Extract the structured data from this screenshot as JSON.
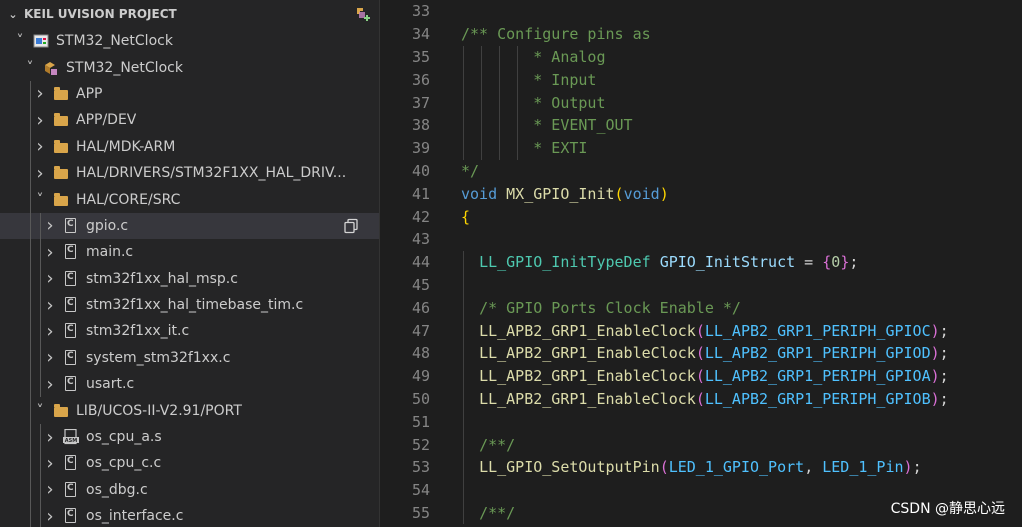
{
  "explorer": {
    "section_title": "KEIL UVISION PROJECT",
    "items": [
      {
        "label": "STM32_NetClock",
        "depth": 1,
        "expanded": true,
        "icon": "project-icon"
      },
      {
        "label": "STM32_NetClock",
        "depth": 2,
        "expanded": true,
        "icon": "target-icon"
      },
      {
        "label": "APP",
        "depth": 3,
        "expanded": false,
        "icon": "folder-icon"
      },
      {
        "label": "APP/DEV",
        "depth": 3,
        "expanded": false,
        "icon": "folder-icon"
      },
      {
        "label": "HAL/MDK-ARM",
        "depth": 3,
        "expanded": false,
        "icon": "folder-icon"
      },
      {
        "label": "HAL/DRIVERS/STM32F1XX_HAL_DRIV...",
        "depth": 3,
        "expanded": false,
        "icon": "folder-icon"
      },
      {
        "label": "HAL/CORE/SRC",
        "depth": 3,
        "expanded": true,
        "icon": "folder-icon"
      },
      {
        "label": "gpio.c",
        "depth": 4,
        "expanded": false,
        "icon": "c-file-icon",
        "selected": true
      },
      {
        "label": "main.c",
        "depth": 4,
        "expanded": false,
        "icon": "c-file-icon"
      },
      {
        "label": "stm32f1xx_hal_msp.c",
        "depth": 4,
        "expanded": false,
        "icon": "c-file-icon"
      },
      {
        "label": "stm32f1xx_hal_timebase_tim.c",
        "depth": 4,
        "expanded": false,
        "icon": "c-file-icon"
      },
      {
        "label": "stm32f1xx_it.c",
        "depth": 4,
        "expanded": false,
        "icon": "c-file-icon"
      },
      {
        "label": "system_stm32f1xx.c",
        "depth": 4,
        "expanded": false,
        "icon": "c-file-icon"
      },
      {
        "label": "usart.c",
        "depth": 4,
        "expanded": false,
        "icon": "c-file-icon"
      },
      {
        "label": "LIB/UCOS-II-V2.91/PORT",
        "depth": 3,
        "expanded": true,
        "icon": "folder-icon"
      },
      {
        "label": "os_cpu_a.s",
        "depth": 4,
        "expanded": false,
        "icon": "asm-file-icon"
      },
      {
        "label": "os_cpu_c.c",
        "depth": 4,
        "expanded": false,
        "icon": "c-file-icon"
      },
      {
        "label": "os_dbg.c",
        "depth": 4,
        "expanded": false,
        "icon": "c-file-icon"
      },
      {
        "label": "os_interface.c",
        "depth": 4,
        "expanded": false,
        "icon": "c-file-icon"
      }
    ]
  },
  "editor": {
    "lines": [
      {
        "n": "33",
        "tokens": []
      },
      {
        "n": "34",
        "tokens": [
          [
            "cm",
            "/** Configure pins as"
          ]
        ]
      },
      {
        "n": "35",
        "tokens": [
          [
            "cm",
            "        * Analog"
          ]
        ]
      },
      {
        "n": "36",
        "tokens": [
          [
            "cm",
            "        * Input"
          ]
        ]
      },
      {
        "n": "37",
        "tokens": [
          [
            "cm",
            "        * Output"
          ]
        ]
      },
      {
        "n": "38",
        "tokens": [
          [
            "cm",
            "        * EVENT_OUT"
          ]
        ]
      },
      {
        "n": "39",
        "tokens": [
          [
            "cm",
            "        * EXTI"
          ]
        ]
      },
      {
        "n": "40",
        "tokens": [
          [
            "cm",
            "*/"
          ]
        ]
      },
      {
        "n": "41",
        "tokens": [
          [
            "kw",
            "void"
          ],
          [
            "pl",
            " "
          ],
          [
            "fn",
            "MX_GPIO_Init"
          ],
          [
            "bk",
            "("
          ],
          [
            "kw",
            "void"
          ],
          [
            "bk",
            ")"
          ]
        ]
      },
      {
        "n": "42",
        "tokens": [
          [
            "bk",
            "{"
          ]
        ]
      },
      {
        "n": "43",
        "tokens": []
      },
      {
        "n": "44",
        "tokens": [
          [
            "pl",
            "  "
          ],
          [
            "ty",
            "LL_GPIO_InitTypeDef"
          ],
          [
            "pl",
            " "
          ],
          [
            "vr",
            "GPIO_InitStruct"
          ],
          [
            "pl",
            " = "
          ],
          [
            "bp",
            "{"
          ],
          [
            "nm",
            "0"
          ],
          [
            "bp",
            "}"
          ],
          [
            "pl",
            ";"
          ]
        ]
      },
      {
        "n": "45",
        "tokens": []
      },
      {
        "n": "46",
        "tokens": [
          [
            "pl",
            "  "
          ],
          [
            "cm",
            "/* GPIO Ports Clock Enable */"
          ]
        ]
      },
      {
        "n": "47",
        "tokens": [
          [
            "pl",
            "  "
          ],
          [
            "fn",
            "LL_APB2_GRP1_EnableClock"
          ],
          [
            "bp",
            "("
          ],
          [
            "mc",
            "LL_APB2_GRP1_PERIPH_GPIOC"
          ],
          [
            "bp",
            ")"
          ],
          [
            "pl",
            ";"
          ]
        ]
      },
      {
        "n": "48",
        "tokens": [
          [
            "pl",
            "  "
          ],
          [
            "fn",
            "LL_APB2_GRP1_EnableClock"
          ],
          [
            "bp",
            "("
          ],
          [
            "mc",
            "LL_APB2_GRP1_PERIPH_GPIOD"
          ],
          [
            "bp",
            ")"
          ],
          [
            "pl",
            ";"
          ]
        ]
      },
      {
        "n": "49",
        "tokens": [
          [
            "pl",
            "  "
          ],
          [
            "fn",
            "LL_APB2_GRP1_EnableClock"
          ],
          [
            "bp",
            "("
          ],
          [
            "mc",
            "LL_APB2_GRP1_PERIPH_GPIOA"
          ],
          [
            "bp",
            ")"
          ],
          [
            "pl",
            ";"
          ]
        ]
      },
      {
        "n": "50",
        "tokens": [
          [
            "pl",
            "  "
          ],
          [
            "fn",
            "LL_APB2_GRP1_EnableClock"
          ],
          [
            "bp",
            "("
          ],
          [
            "mc",
            "LL_APB2_GRP1_PERIPH_GPIOB"
          ],
          [
            "bp",
            ")"
          ],
          [
            "pl",
            ";"
          ]
        ]
      },
      {
        "n": "51",
        "tokens": []
      },
      {
        "n": "52",
        "tokens": [
          [
            "pl",
            "  "
          ],
          [
            "cm",
            "/**/"
          ]
        ]
      },
      {
        "n": "53",
        "tokens": [
          [
            "pl",
            "  "
          ],
          [
            "fn",
            "LL_GPIO_SetOutputPin"
          ],
          [
            "bp",
            "("
          ],
          [
            "mc",
            "LED_1_GPIO_Port"
          ],
          [
            "pl",
            ", "
          ],
          [
            "mc",
            "LED_1_Pin"
          ],
          [
            "bp",
            ")"
          ],
          [
            "pl",
            ";"
          ]
        ]
      },
      {
        "n": "54",
        "tokens": []
      },
      {
        "n": "55",
        "tokens": [
          [
            "pl",
            "  "
          ],
          [
            "cm",
            "/**/"
          ]
        ]
      }
    ]
  },
  "watermark": "CSDN @静思心远"
}
